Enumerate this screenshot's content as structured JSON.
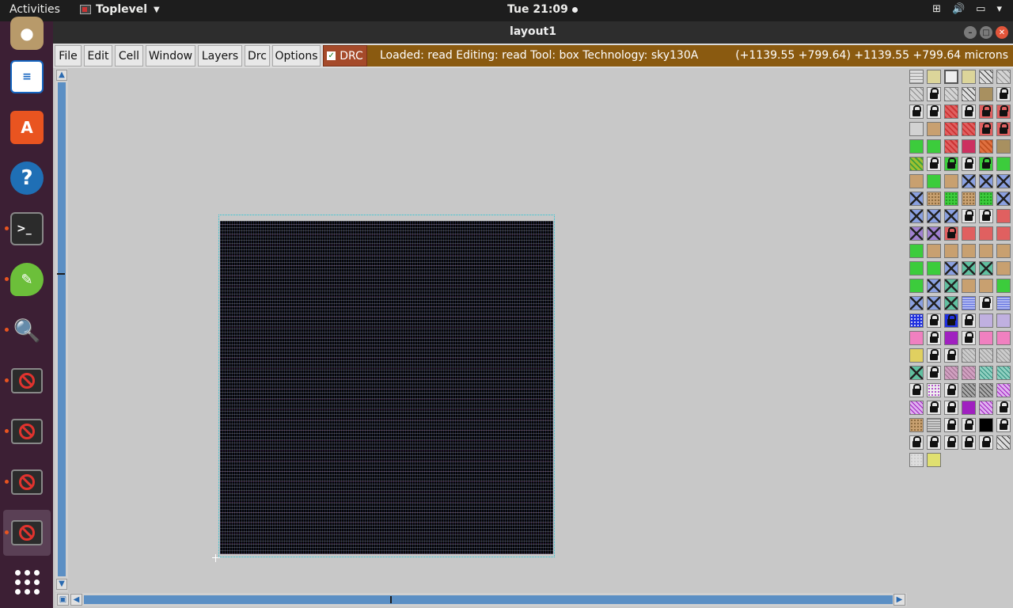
{
  "topbar": {
    "activities": "Activities",
    "app_name": "Toplevel",
    "clock": "Tue 21:09"
  },
  "window": {
    "title": "layout1"
  },
  "menu": {
    "items": [
      "File",
      "Edit",
      "Cell",
      "Window",
      "Layers",
      "Drc",
      "Options"
    ],
    "drc_label": "DRC",
    "drc_checked": true
  },
  "status": {
    "left": "Loaded: read Editing: read Tool: box  Technology: sky130A",
    "right": "(+1139.55 +799.64) +1139.55 +799.64 microns"
  },
  "dock": {
    "icons": [
      "speaker-icon",
      "writer-document-icon",
      "software-store-icon",
      "help-icon",
      "terminal-icon",
      "text-editor-icon",
      "image-viewer-icon",
      "blocked-app-icon",
      "blocked-app-icon",
      "blocked-app-icon",
      "blocked-app-icon",
      "show-applications-icon"
    ]
  },
  "colors": {
    "status_bg": "#8a5a10",
    "drc_bg": "#a54a2a",
    "scroll_blue": "#5b8fc4",
    "dock_bg": "#3c1f34"
  },
  "layers": {
    "palette": [
      [
        "grid",
        "tan-light",
        "box-outline",
        "tan-light",
        "hatch-dark",
        "hatch-grey"
      ],
      [
        "hatch-grey",
        "lock",
        "hatch-grey",
        "hatch-dark",
        "olive",
        "lock"
      ],
      [
        "lock",
        "lock",
        "red",
        "lock",
        "lock-red",
        "lock-red"
      ],
      [
        "grey-light",
        "tan",
        "red",
        "red",
        "lock-red",
        "lock-red"
      ],
      [
        "green",
        "green",
        "red",
        "magenta",
        "orange",
        "olive"
      ],
      [
        "green-hatch",
        "lock",
        "lock-green",
        "lock",
        "lock-green",
        "green"
      ],
      [
        "tan",
        "green",
        "tan",
        "x-blue",
        "x-blue",
        "x-blue"
      ],
      [
        "x-blue",
        "tan-dot",
        "green-dot",
        "tan-dot",
        "green-dot",
        "x-blue"
      ],
      [
        "x-blue",
        "x-blue",
        "x-blue",
        "lock",
        "lock",
        "salmon"
      ],
      [
        "x-purple",
        "x-purple",
        "lock-red",
        "salmon",
        "salmon",
        "salmon"
      ],
      [
        "green",
        "tan",
        "tan",
        "tan",
        "tan",
        "tan"
      ],
      [
        "green",
        "green",
        "x-blue",
        "x-teal",
        "x-teal",
        "tan"
      ],
      [
        "green",
        "x-blue",
        "x-teal",
        "tan",
        "tan",
        "green"
      ],
      [
        "x-blue",
        "x-blue",
        "x-teal",
        "blue-wave",
        "lock",
        "blue-wave"
      ],
      [
        "blue-dot",
        "lock",
        "lock-blue",
        "lock",
        "lavender",
        "lavender"
      ],
      [
        "pink",
        "lock",
        "purple",
        "lock",
        "pink",
        "pink"
      ],
      [
        "yellow",
        "lock",
        "lock",
        "grey-x",
        "grey-x",
        "grey-x"
      ],
      [
        "x-teal",
        "lock",
        "mauve",
        "mauve",
        "teal",
        "teal"
      ],
      [
        "lock",
        "purple-dot",
        "lock",
        "grey-dark",
        "grey-dark",
        "purple-hatch"
      ],
      [
        "purple-hatch",
        "lock",
        "lock",
        "purple",
        "purple-hatch",
        "lock"
      ],
      [
        "tan-dot",
        "grey-wave",
        "lock",
        "lock",
        "black",
        "lock"
      ],
      [
        "lock",
        "lock",
        "lock",
        "lock",
        "lock",
        "hatch-dark"
      ],
      [
        "dots-light",
        "yellow-light"
      ]
    ]
  }
}
